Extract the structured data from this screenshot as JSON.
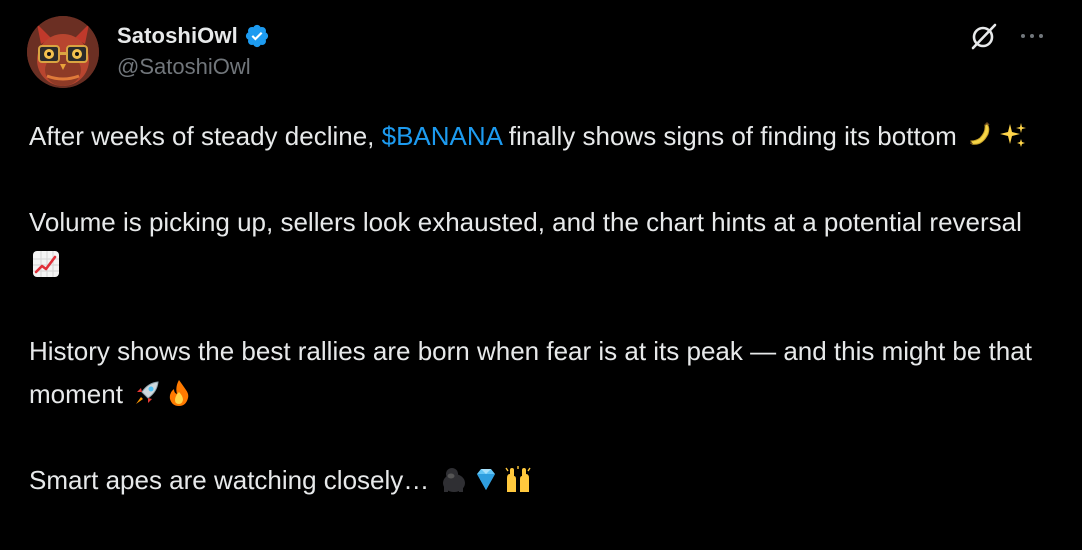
{
  "author": {
    "display_name": "SatoshiOwl",
    "handle": "@SatoshiOwl",
    "verified": true,
    "avatar_icon": "owl-avatar"
  },
  "actions": {
    "grok_icon": "grok-slash-icon",
    "more_icon": "more-dots-icon",
    "more_label": "···"
  },
  "post": {
    "p1_pre": "After weeks of steady decline, ",
    "p1_cashtag": "$BANANA",
    "p1_post": " finally shows signs of finding its bottom ",
    "p2_text": "Volume is picking up, sellers look exhausted, and the chart hints at a potential reversal ",
    "p3_text": "History shows the best rallies are born when fear is at its peak — and this might be that moment ",
    "p4_text": "Smart apes are watching closely… "
  },
  "emojis": [
    "banana",
    "sparkles",
    "chart-increasing",
    "rocket",
    "fire",
    "gorilla",
    "gem",
    "raising-hands"
  ],
  "colors": {
    "background": "#000000",
    "text": "#e7e9ea",
    "secondary_text": "#71767b",
    "accent": "#1d9bf0"
  }
}
